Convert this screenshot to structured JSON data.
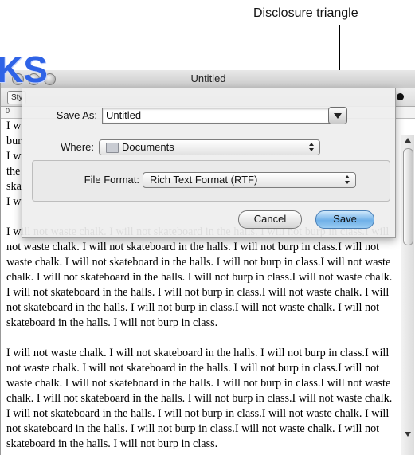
{
  "annotation": {
    "callout_label": "Disclosure triangle"
  },
  "watermark_text": "KS",
  "window": {
    "title": "Untitled",
    "toolbar": {
      "style_label": "Sty"
    },
    "ruler": {
      "zero_label": "0"
    }
  },
  "save_sheet": {
    "save_as_label": "Save As:",
    "save_as_value": "Untitled",
    "where_label": "Where:",
    "where_value": "Documents",
    "file_format_label": "File Format:",
    "file_format_value": "Rich Text Format (RTF)",
    "cancel_label": "Cancel",
    "save_label": "Save"
  },
  "document": {
    "visible_fragments": [
      "I w",
      "bur",
      "I w",
      "the",
      "ska",
      "I w"
    ],
    "paragraphs": [
      "I will not waste chalk. I will not skateboard in the halls. I will not burp in class.I will not waste chalk. I will not skateboard in the halls. I will not burp in class.I will not waste chalk. I will not skateboard in the halls. I will not burp in class.I will not waste chalk. I will not skateboard in the halls. I will not burp in class.I will not waste chalk. I will not skateboard in the halls. I will not burp in class.I will not waste chalk. I will not skateboard in the halls. I will not burp in class.I will not waste chalk. I will not skateboard in the halls. I will not burp in class.",
      "I will not waste chalk. I will not skateboard in the halls. I will not burp in class.I will not waste chalk. I will not skateboard in the halls. I will not burp in class.I will not waste chalk. I will not skateboard in the halls. I will not burp in class.I will not waste chalk. I will not skateboard in the halls. I will not burp in class.I will not waste chalk. I will not skateboard in the halls. I will not burp in class.I will not waste chalk. I will not skateboard in the halls. I will not burp in class.I will not waste chalk. I will not skateboard in the halls. I will not burp in class."
    ]
  }
}
